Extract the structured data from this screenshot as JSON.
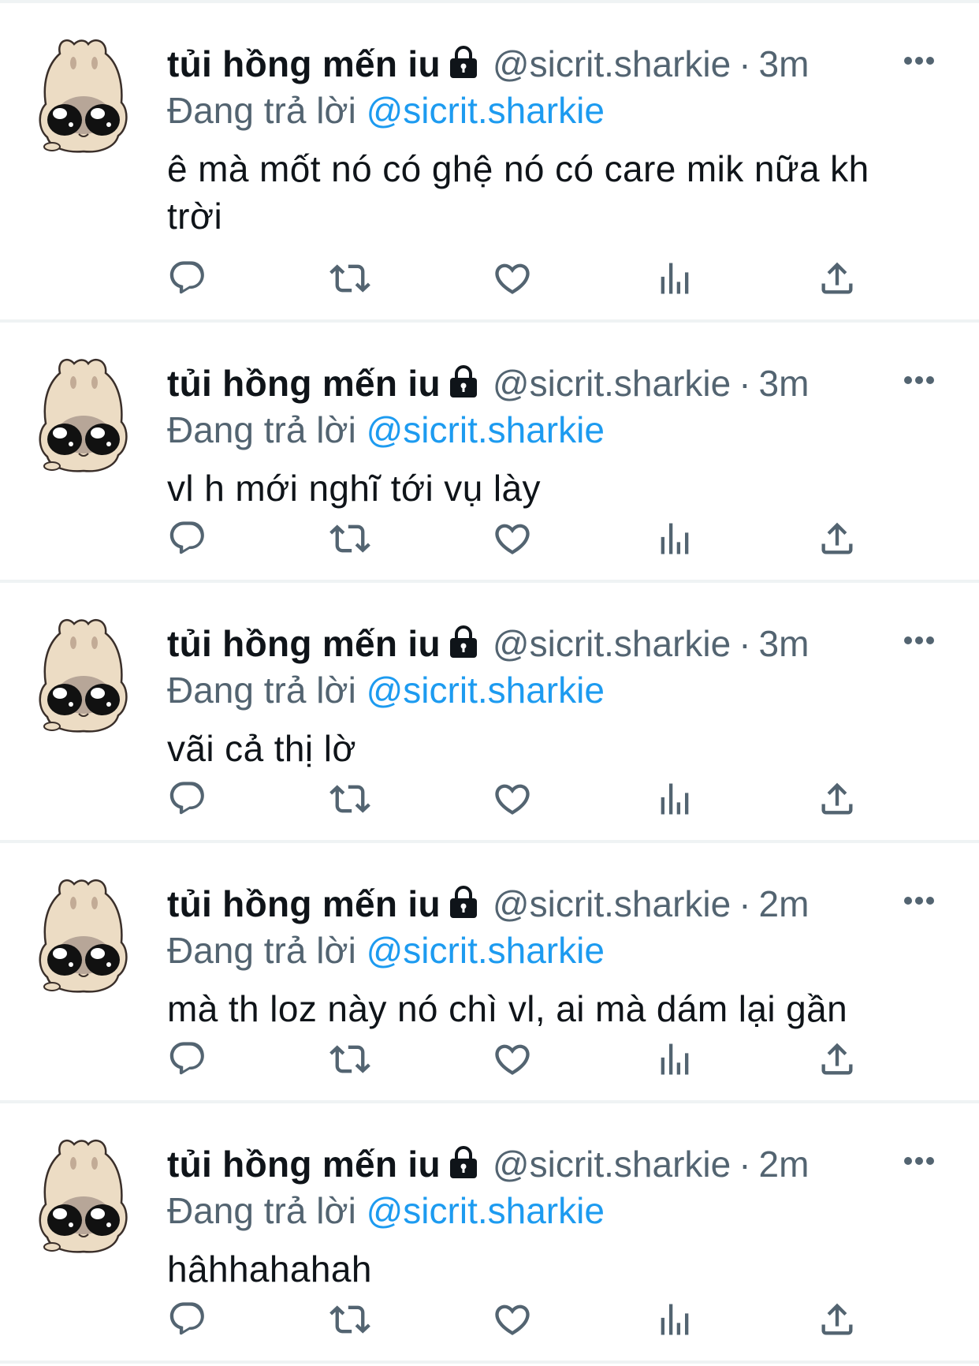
{
  "accent_color": "#1d9bf0",
  "secondary_text_color": "#536471",
  "tweets": [
    {
      "name": "tủi hồng mến iu",
      "handle": "@sicrit.sharkie",
      "separator": "·",
      "time": "3m",
      "replying_prefix": "Đang trả lời",
      "replying_to": "@sicrit.sharkie",
      "text": "ê mà mốt nó có ghệ nó có care mik nữa kh trời",
      "icons": [
        "lock-icon",
        "more-icon",
        "reply-icon",
        "retweet-icon",
        "like-icon",
        "views-icon",
        "share-icon"
      ]
    },
    {
      "name": "tủi hồng mến iu",
      "handle": "@sicrit.sharkie",
      "separator": "·",
      "time": "3m",
      "replying_prefix": "Đang trả lời",
      "replying_to": "@sicrit.sharkie",
      "text": "vl h mới nghĩ tới vụ lày"
    },
    {
      "name": "tủi hồng mến iu",
      "handle": "@sicrit.sharkie",
      "separator": "·",
      "time": "3m",
      "replying_prefix": "Đang trả lời",
      "replying_to": "@sicrit.sharkie",
      "text": "vãi cả thị lờ"
    },
    {
      "name": "tủi hồng mến iu",
      "handle": "@sicrit.sharkie",
      "separator": "·",
      "time": "2m",
      "replying_prefix": "Đang trả lời",
      "replying_to": "@sicrit.sharkie",
      "text": "mà th loz này nó chì vl, ai mà dám lại gần"
    },
    {
      "name": "tủi hồng mến iu",
      "handle": "@sicrit.sharkie",
      "separator": "·",
      "time": "2m",
      "replying_prefix": "Đang trả lời",
      "replying_to": "@sicrit.sharkie",
      "text": "hâhhahahah"
    }
  ]
}
